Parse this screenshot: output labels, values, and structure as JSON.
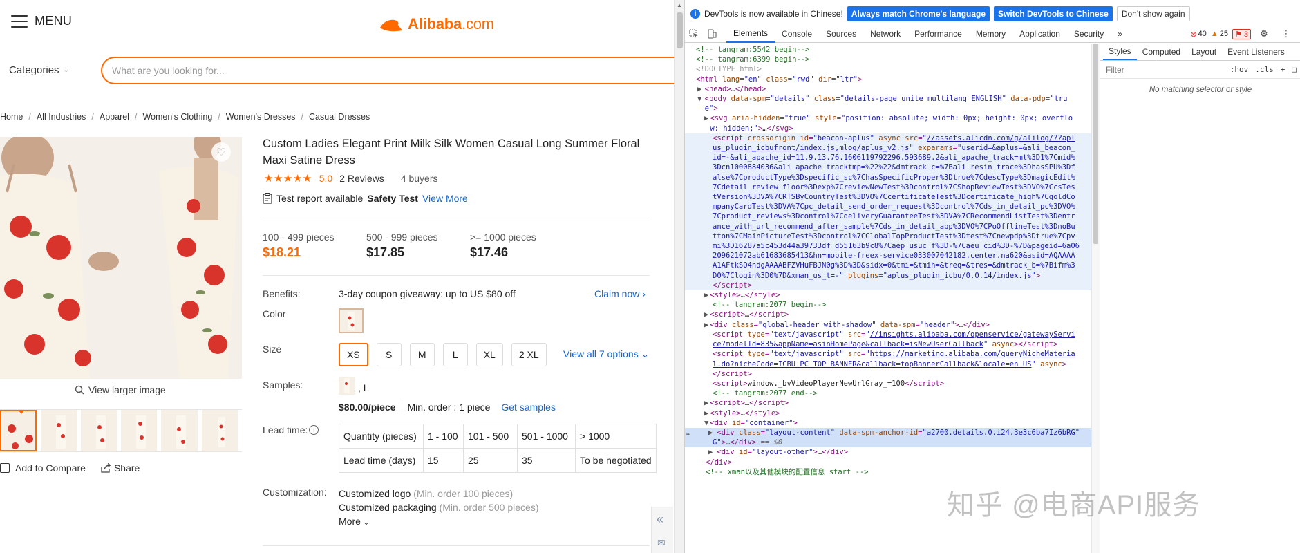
{
  "header": {
    "menu_label": "MENU",
    "logo_text": "Alibaba",
    "logo_suffix": ".com",
    "categories_label": "Categories",
    "search_placeholder": "What are you looking for..."
  },
  "breadcrumb": [
    "Home",
    "All Industries",
    "Apparel",
    "Women's Clothing",
    "Women's Dresses",
    "Casual Dresses"
  ],
  "gallery": {
    "view_larger": "View larger image",
    "add_to_compare": "Add to Compare",
    "share": "Share"
  },
  "product": {
    "title": "Custom Ladies Elegant Print Milk Silk Women Casual Long Summer Floral Maxi Satine Dress",
    "rating": "5.0",
    "reviews": "2 Reviews",
    "buyers": "4 buyers",
    "test_report_prefix": "Test report available",
    "test_report_bold": "Safety Test",
    "test_report_link": "View More",
    "prices": [
      {
        "qty": "100 - 499 pieces",
        "price": "$18.21",
        "highlight": true
      },
      {
        "qty": "500 - 999 pieces",
        "price": "$17.85",
        "highlight": false
      },
      {
        "qty": ">= 1000 pieces",
        "price": "$17.46",
        "highlight": false
      }
    ],
    "benefits_label": "Benefits:",
    "benefits_text": "3-day coupon giveaway: up to US $80 off",
    "claim_now": "Claim now",
    "color_label": "Color",
    "size_label": "Size",
    "sizes": [
      "XS",
      "S",
      "M",
      "L",
      "XL",
      "2 XL"
    ],
    "selected_size": "XS",
    "view_all_options": "View all 7 options",
    "samples_label": "Samples:",
    "sample_variant": ", L",
    "sample_price": "$80.00/piece",
    "min_order": "Min. order : 1 piece",
    "get_samples": "Get samples",
    "lead_time_label": "Lead time:",
    "lead_table": [
      [
        "Quantity (pieces)",
        "1 - 100",
        "101 - 500",
        "501 - 1000",
        "> 1000"
      ],
      [
        "Lead time (days)",
        "15",
        "25",
        "35",
        "To be negotiated"
      ]
    ],
    "customization_label": "Customization:",
    "customization": [
      {
        "text": "Customized logo",
        "note": "(Min. order 100 pieces)"
      },
      {
        "text": "Customized packaging",
        "note": "(Min. order 500 pieces)"
      }
    ],
    "more": "More"
  },
  "devtools": {
    "infobar_text": "DevTools is now available in Chinese!",
    "btn_match": "Always match Chrome's language",
    "btn_switch": "Switch DevTools to Chinese",
    "btn_dismiss": "Don't show again",
    "tabs": [
      "Elements",
      "Console",
      "Sources",
      "Network",
      "Performance",
      "Memory",
      "Application",
      "Security"
    ],
    "active_tab": "Elements",
    "errors": "40",
    "warnings": "25",
    "issues": "3",
    "styles_tabs": [
      "Styles",
      "Computed",
      "Layout",
      "Event Listeners"
    ],
    "filter_placeholder": "Filter",
    "filter_hov": ":hov",
    "filter_cls": ".cls",
    "no_match": "No matching selector or style"
  },
  "watermark": "知乎 @电商API服务",
  "colors": {
    "brand_orange": "#ff6a00",
    "link_blue": "#1a66cc",
    "devtools_blue": "#1a73e8"
  }
}
